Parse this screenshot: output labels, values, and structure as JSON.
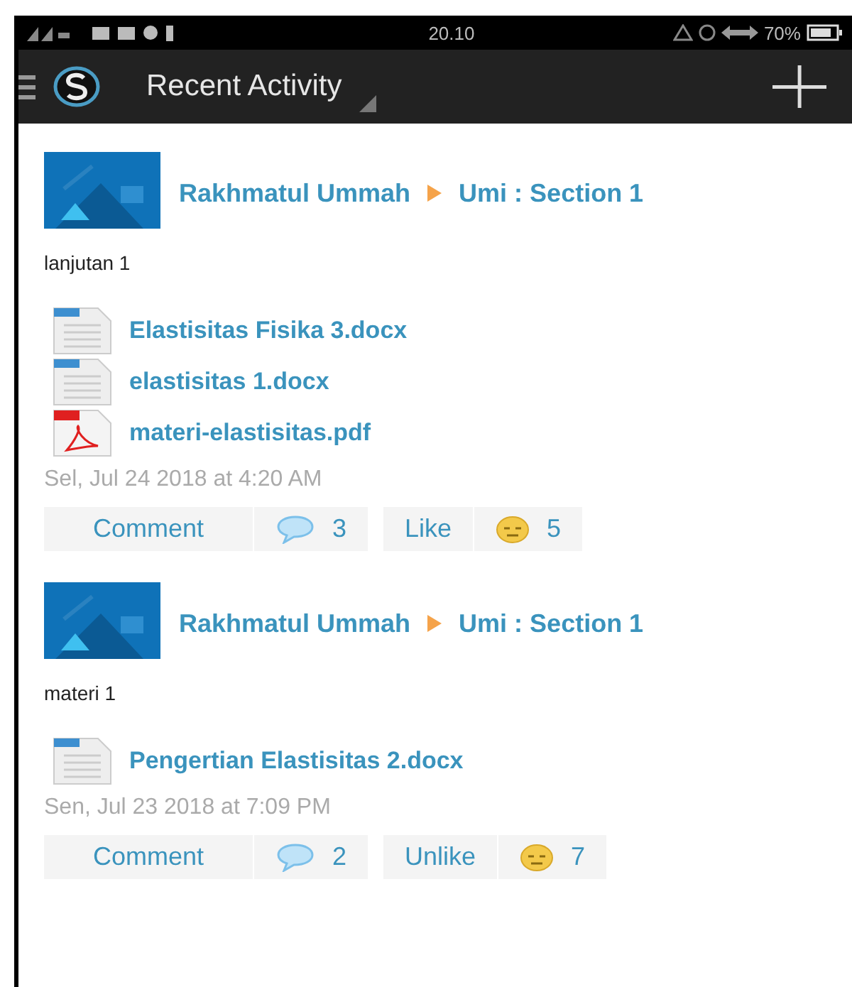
{
  "status_bar": {
    "time": "20.10",
    "battery": "70%"
  },
  "app_bar": {
    "title": "Recent Activity"
  },
  "posts": [
    {
      "author": "Rakhmatul Ummah",
      "target": "Umi : Section 1",
      "text": "lanjutan 1",
      "files": [
        {
          "name": "Elastisitas Fisika 3.docx",
          "kind": "doc"
        },
        {
          "name": "elastisitas 1.docx",
          "kind": "doc"
        },
        {
          "name": "materi-elastisitas.pdf",
          "kind": "pdf"
        }
      ],
      "date": "Sel, Jul 24 2018 at 4:20 AM",
      "comment_label": "Comment",
      "comment_count": "3",
      "like_label": "Like",
      "like_count": "5"
    },
    {
      "author": "Rakhmatul Ummah",
      "target": "Umi : Section 1",
      "text": "materi 1",
      "files": [
        {
          "name": "Pengertian Elastisitas 2.docx",
          "kind": "doc"
        }
      ],
      "date": "Sen, Jul 23 2018 at 7:09 PM",
      "comment_label": "Comment",
      "comment_count": "2",
      "like_label": "Unlike",
      "like_count": "7"
    }
  ]
}
